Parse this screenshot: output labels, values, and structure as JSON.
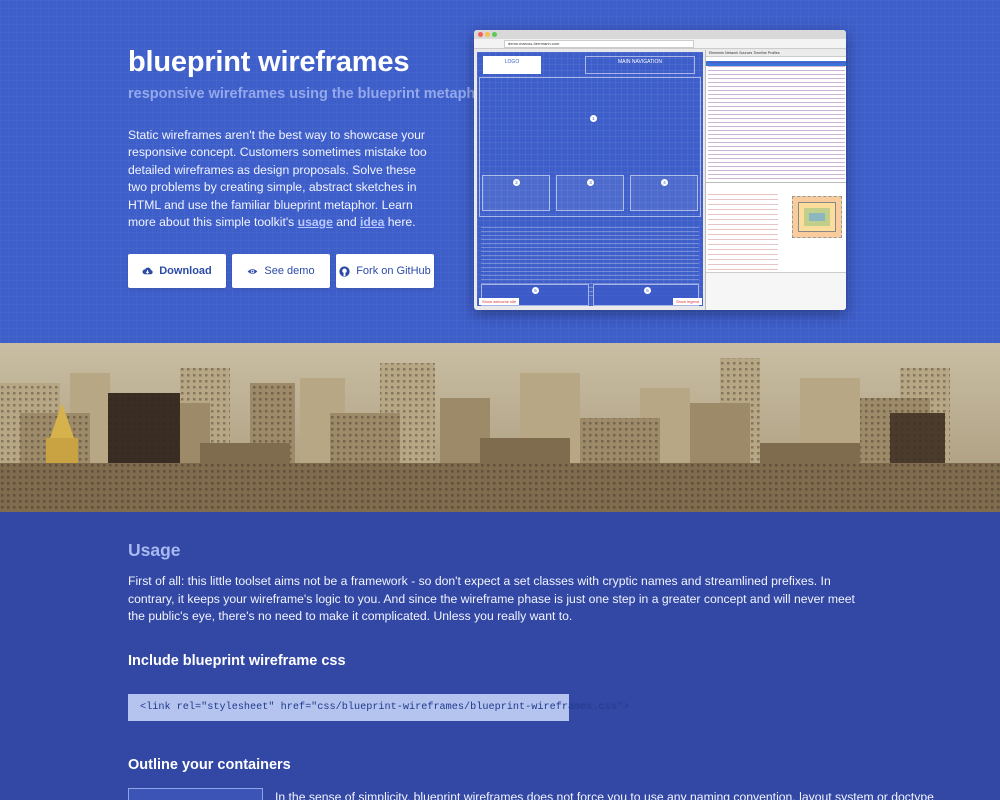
{
  "hero": {
    "title": "blueprint wireframes",
    "subtitle": "responsive wireframes using the blueprint metaphor",
    "description_before": "Static wireframes aren't the best way to showcase your responsive concept. Customers sometimes mistake too detailed wireframes as design proposals. Solve these two problems by creating simple, abstract sketches in HTML and use the familiar blueprint metaphor. Learn more about this simple toolkit's ",
    "link_usage": "usage",
    "description_and": " and ",
    "link_idea": "idea",
    "description_after": " here.",
    "buttons": {
      "download": "Download",
      "demo": "See demo",
      "github": "Fork on GitHub"
    }
  },
  "mock": {
    "url": "demo.marcus-herrmann.com",
    "logo_label": "LOGO",
    "nav_label": "MAIN NAVIGATION",
    "numbers": [
      "1",
      "2",
      "3",
      "4",
      "5",
      "6"
    ],
    "footer_left_tag": "Show welcome site",
    "footer_right_tag": "Show legend",
    "devtools_tabs": "Elements  Network  Sources  Timeline  Profiles"
  },
  "usage": {
    "title": "Usage",
    "intro": "First of all: this little toolset aims not be a framework - so don't expect a set classes with cryptic names and streamlined prefixes. In contrary, it keeps your wireframe's logic to you. And since the wireframe phase is just one step in a greater concept and will never meet the public's eye, there's no need to make it complicated. Unless you really want to.",
    "include_heading": "Include blueprint wireframe css",
    "include_code": "<link rel=\"stylesheet\" href=\"css/blueprint-wireframes/blueprint-wireframes.css\">",
    "outline_heading": "Outline your containers",
    "outline_text": "In the sense of simplicity, blueprint wireframes does not force you to use any naming convention, layout system or doctype"
  },
  "colors": {
    "hero_bg": "#3e5ec9",
    "usage_bg": "#3348a4",
    "subtitle": "#93a9ec",
    "code_bg": "#b4c4ef"
  }
}
